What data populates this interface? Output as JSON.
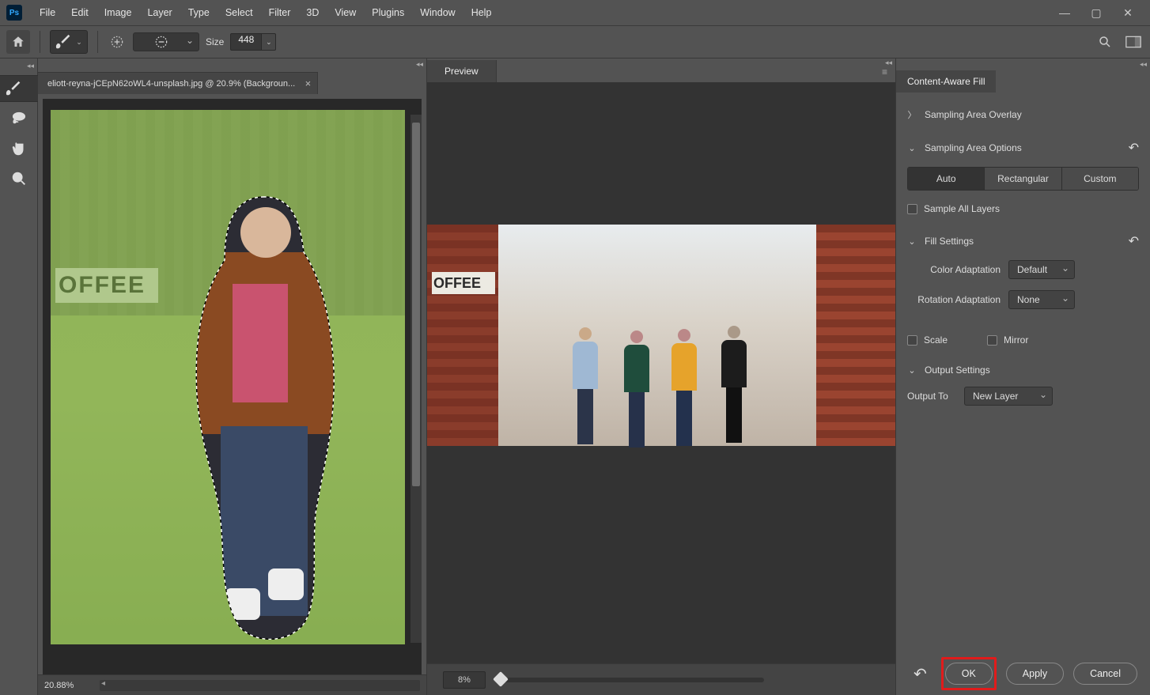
{
  "menu": {
    "items": [
      "File",
      "Edit",
      "Image",
      "Layer",
      "Type",
      "Select",
      "Filter",
      "3D",
      "View",
      "Plugins",
      "Window",
      "Help"
    ]
  },
  "logo": "Ps",
  "optbar": {
    "size_label": "Size",
    "size_value": "448"
  },
  "tools": [
    "brush",
    "lasso",
    "hand",
    "zoom"
  ],
  "doc_tab": {
    "title": "eliott-reyna-jCEpN62oWL4-unsplash.jpg @ 20.9% (Backgroun..."
  },
  "status": {
    "zoom": "20.88%"
  },
  "canvas": {
    "sign": "OFFEE"
  },
  "preview": {
    "title": "Preview",
    "zoom": "8%",
    "sign": "OFFEE"
  },
  "caf": {
    "title": "Content-Aware Fill",
    "sections": {
      "sa_overlay": "Sampling Area Overlay",
      "sa_options": "Sampling Area Options",
      "fill": "Fill Settings",
      "output": "Output Settings"
    },
    "seg": [
      "Auto",
      "Rectangular",
      "Custom"
    ],
    "sample_all": "Sample All Layers",
    "color_adapt_label": "Color Adaptation",
    "color_adapt_value": "Default",
    "rot_adapt_label": "Rotation Adaptation",
    "rot_adapt_value": "None",
    "scale": "Scale",
    "mirror": "Mirror",
    "output_to_label": "Output To",
    "output_to_value": "New Layer",
    "buttons": {
      "ok": "OK",
      "apply": "Apply",
      "cancel": "Cancel"
    }
  }
}
